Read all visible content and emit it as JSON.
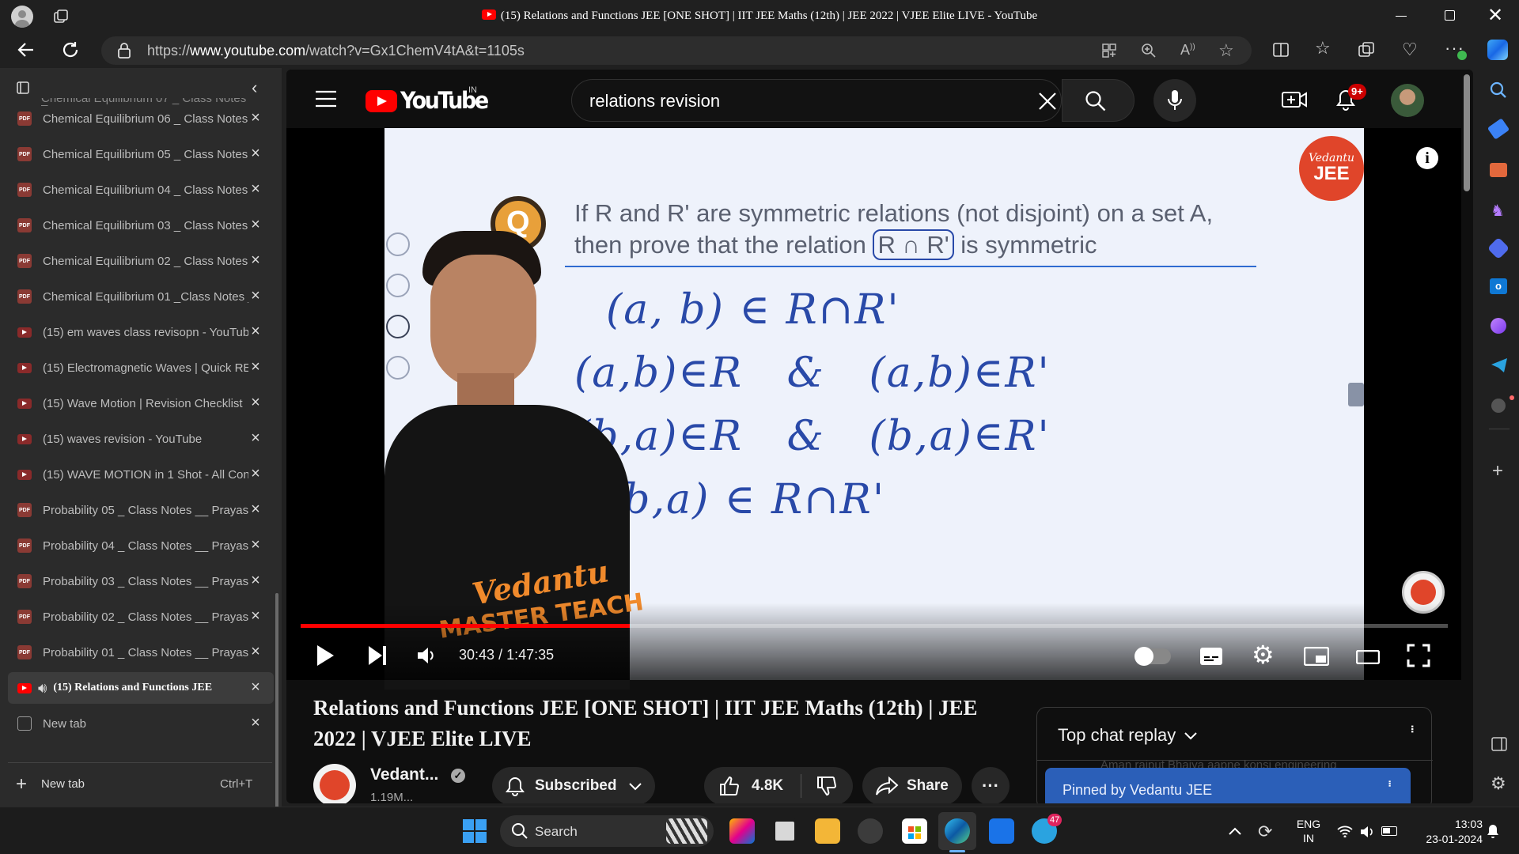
{
  "window": {
    "title": "(15) Relations and Functions JEE [ONE SHOT] | IIT JEE Maths (12th) | JEE 2022 | VJEE Elite LIVE - YouTube"
  },
  "browser": {
    "url_prefix": "https://",
    "url_domain": "www.youtube.com",
    "url_path": "/watch?v=Gx1ChemV4tA&t=1105s"
  },
  "sidebar": {
    "tabs": [
      {
        "label": "Chemical Equilibrium 06 _ Class Notes _",
        "type": "pdf",
        "active": false
      },
      {
        "label": "Chemical Equilibrium 05 _ Class Notes _",
        "type": "pdf",
        "active": false
      },
      {
        "label": "Chemical Equilibrium 04 _ Class Notes _",
        "type": "pdf",
        "active": false
      },
      {
        "label": "Chemical Equilibrium 03 _ Class Notes _",
        "type": "pdf",
        "active": false
      },
      {
        "label": "Chemical Equilibrium 02 _ Class Notes _",
        "type": "pdf",
        "active": false
      },
      {
        "label": "Chemical Equilibrium 01 _Class Notes _",
        "type": "pdf",
        "active": false
      },
      {
        "label": "(15) em waves class revisopn - YouTube",
        "type": "yt",
        "active": false
      },
      {
        "label": "(15) Electromagnetic Waves | Quick RE",
        "type": "yt",
        "active": false
      },
      {
        "label": "(15) Wave Motion | Revision Checklist",
        "type": "yt",
        "active": false
      },
      {
        "label": "(15) waves revision - YouTube",
        "type": "yt",
        "active": false
      },
      {
        "label": "(15) WAVE MOTION in 1 Shot - All Con",
        "type": "yt",
        "active": false
      },
      {
        "label": "Probability 05 _ Class Notes __ Prayas J",
        "type": "pdf",
        "active": false
      },
      {
        "label": "Probability 04 _ Class Notes __ Prayas J",
        "type": "pdf",
        "active": false
      },
      {
        "label": "Probability 03 _ Class Notes __ Prayas J",
        "type": "pdf",
        "active": false
      },
      {
        "label": "Probability 02 _ Class Notes __ Prayas J",
        "type": "pdf",
        "active": false
      },
      {
        "label": "Probability 01 _ Class Notes __ Prayas J",
        "type": "pdf",
        "active": false
      },
      {
        "label": "(15) Relations and Functions JEE",
        "type": "yt",
        "active": true
      },
      {
        "label": "New tab",
        "type": "newtab",
        "active": false
      }
    ],
    "new_tab_label": "New tab",
    "new_tab_shortcut": "Ctrl+T"
  },
  "youtube": {
    "logo_text": "YouTube",
    "region": "IN",
    "search_query": "relations revision",
    "notification_count": "9+"
  },
  "video": {
    "question_letter": "Q",
    "question_line1": "If R and R' are symmetric relations (not disjoint) on a set A,",
    "question_line2_a": "then prove that the relation",
    "question_line2_box": "R ∩ R'",
    "question_line2_b": "is symmetric",
    "hand_lines": [
      "(a, b) ∈ R∩R'",
      "(a,b)∈R   &   (a,b)∈R'",
      "(b,a)∈R   &   (b,a)∈R'",
      "(b,a) ∈ R∩R'"
    ],
    "shirt_line1": "Vedantu",
    "shirt_line2": "MASTER TEACHER",
    "brand_logo_line1": "Vedantu",
    "brand_logo_line2": "JEE",
    "time_current": "30:43",
    "time_total": "1:47:35",
    "time_separator": "/",
    "progress": 0.287
  },
  "video_info": {
    "title": "Relations and Functions JEE [ONE SHOT] | IIT JEE Maths (12th) | JEE 2022 | VJEE Elite LIVE",
    "channel_name": "Vedant...",
    "subscribers": "1.19M...",
    "subscribed_label": "Subscribed",
    "likes": "4.8K",
    "share_label": "Share"
  },
  "chat": {
    "header": "Top chat replay",
    "faded_message": "Aman rajput  Bhaiya aapne konsi engineering",
    "pinned_label": "Pinned by Vedantu JEE"
  },
  "taskbar": {
    "search_placeholder": "Search",
    "lang_line1": "ENG",
    "lang_line2": "IN",
    "time": "13:03",
    "date": "23-01-2024",
    "telegram_badge": "47"
  }
}
